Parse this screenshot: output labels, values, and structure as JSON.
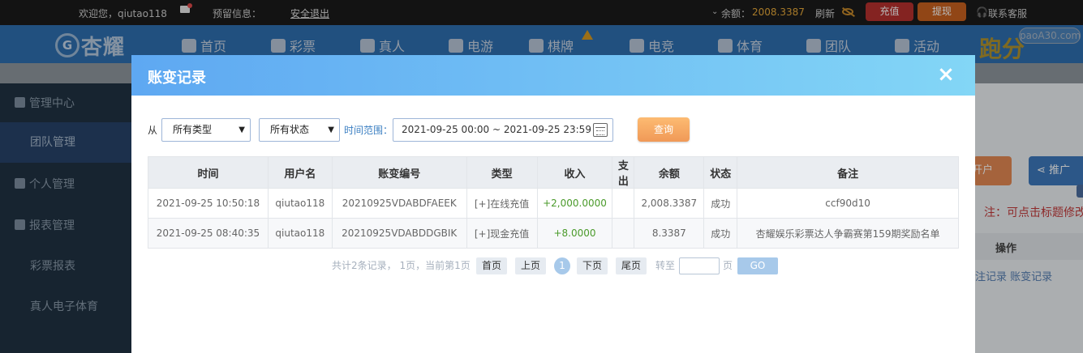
{
  "topbar": {
    "welcome": "欢迎您，qiutao118",
    "notice_label": "预留信息：",
    "logout": "安全退出",
    "balance_label": "余额：",
    "balance_value": "2008.3387",
    "refresh": "刷新",
    "charge": "充值",
    "withdraw": "提现",
    "service": "联系客服"
  },
  "nav": {
    "logo_text": "杏耀",
    "items": [
      "首页",
      "彩票",
      "真人",
      "电游",
      "棋牌",
      "电竞",
      "体育",
      "团队",
      "活动"
    ],
    "promo": "跑分",
    "watermark": "paoA30.com"
  },
  "sidebar": {
    "items": [
      "管理中心",
      "团队管理",
      "个人管理",
      "报表管理",
      "彩票报表",
      "真人电子体育"
    ]
  },
  "background": {
    "btn1": "开户",
    "btn2": "推广",
    "note": "注：可点击标题修改",
    "op_header": "操作",
    "links": "注记录  账变记录"
  },
  "modal": {
    "title": "账变记录",
    "close": "×",
    "filter": {
      "from": "从",
      "type_select": "所有类型",
      "status_select": "所有状态",
      "range_label": "时间范围：",
      "range_value": "2021-09-25 00:00 ~ 2021-09-25 23:59",
      "query": "查询"
    },
    "table": {
      "headers": [
        "时间",
        "用户名",
        "账变编号",
        "类型",
        "收入",
        "支出",
        "余额",
        "状态",
        "备注"
      ],
      "rows": [
        [
          "2021-09-25 10:50:18",
          "qiutao118",
          "20210925VDABDFAEEK",
          "[+]在线充值",
          "+2,000.0000",
          "",
          "2,008.3387",
          "成功",
          "ccf90d10"
        ],
        [
          "2021-09-25 08:40:35",
          "qiutao118",
          "20210925VDABDDGBIK",
          "[+]现金充值",
          "+8.0000",
          "",
          "8.3387",
          "成功",
          "杏耀娱乐彩票达人争霸赛第159期奖励名单"
        ]
      ]
    },
    "pager": {
      "info": "共计2条记录， 1页，当前第1页",
      "first": "首页",
      "prev": "上页",
      "current": "1",
      "next": "下页",
      "last": "尾页",
      "goto": "转至",
      "page_unit": "页",
      "go": "GO"
    }
  }
}
